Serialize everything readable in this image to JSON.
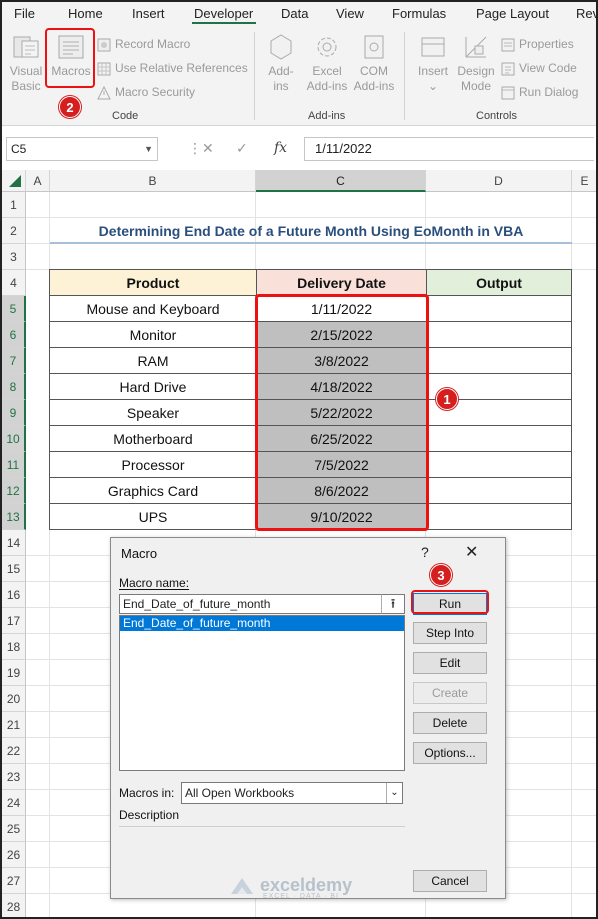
{
  "ribbon_tabs": [
    "File",
    "Home",
    "Insert",
    "Developer",
    "Data",
    "View",
    "Formulas",
    "Page Layout",
    "Rev"
  ],
  "code_group": {
    "visual_basic": [
      "Visual",
      "Basic"
    ],
    "macros": "Macros",
    "record_macro": "Record Macro",
    "relative_refs": "Use Relative References",
    "macro_security": "Macro Security",
    "label": "Code"
  },
  "addins_group": {
    "addins": [
      "Add-",
      "ins"
    ],
    "excel_addins": [
      "Excel",
      "Add-ins"
    ],
    "com_addins": [
      "COM",
      "Add-ins"
    ],
    "label": "Add-ins"
  },
  "controls_group": {
    "insert": "Insert",
    "design_mode": [
      "Design",
      "Mode"
    ],
    "properties": "Properties",
    "view_code": "View Code",
    "run_dialog": "Run Dialog",
    "label": "Controls"
  },
  "formula_bar": {
    "name_box": "C5",
    "fx": "fx",
    "value": "1/11/2022"
  },
  "columns": [
    "A",
    "B",
    "C",
    "D",
    "E"
  ],
  "rows": [
    "1",
    "2",
    "3",
    "4",
    "5",
    "6",
    "7",
    "8",
    "9",
    "10",
    "11",
    "12",
    "13",
    "14",
    "15",
    "16",
    "17",
    "18",
    "19",
    "20",
    "21",
    "22",
    "23",
    "24",
    "25",
    "26",
    "27",
    "28"
  ],
  "sheet_title": "Determining End Date of a Future Month Using EoMonth in VBA",
  "table": {
    "headers": [
      "Product",
      "Delivery Date",
      "Output"
    ],
    "rows": [
      {
        "product": "Mouse and Keyboard",
        "date": "1/11/2022",
        "output": ""
      },
      {
        "product": "Monitor",
        "date": "2/15/2022",
        "output": ""
      },
      {
        "product": "RAM",
        "date": "3/8/2022",
        "output": ""
      },
      {
        "product": "Hard Drive",
        "date": "4/18/2022",
        "output": ""
      },
      {
        "product": "Speaker",
        "date": "5/22/2022",
        "output": ""
      },
      {
        "product": "Motherboard",
        "date": "6/25/2022",
        "output": ""
      },
      {
        "product": "Processor",
        "date": "7/5/2022",
        "output": ""
      },
      {
        "product": "Graphics Card",
        "date": "8/6/2022",
        "output": ""
      },
      {
        "product": "UPS",
        "date": "9/10/2022",
        "output": ""
      }
    ]
  },
  "callouts": [
    "1",
    "2",
    "3"
  ],
  "dialog": {
    "title": "Macro",
    "help": "?",
    "close": "✕",
    "macro_name_label": "Macro name:",
    "macro_name_value": "End_Date_of_future_month",
    "macro_list": [
      "End_Date_of_future_month"
    ],
    "buttons": {
      "run": "Run",
      "step_into": "Step Into",
      "edit": "Edit",
      "create": "Create",
      "delete": "Delete",
      "options": "Options...",
      "cancel": "Cancel"
    },
    "macros_in_label": "Macros in:",
    "macros_in_value": "All Open Workbooks",
    "description_label": "Description"
  },
  "watermark": {
    "brand": "exceldemy",
    "tagline": "EXCEL · DATA · BI"
  },
  "colors": {
    "header_product": "#fdf1d6",
    "header_delivery": "#f9e0d9",
    "header_output": "#e2efda",
    "selection_fill": "#bfbfbf",
    "highlight_red": "#e11111",
    "excel_green": "#217346"
  }
}
